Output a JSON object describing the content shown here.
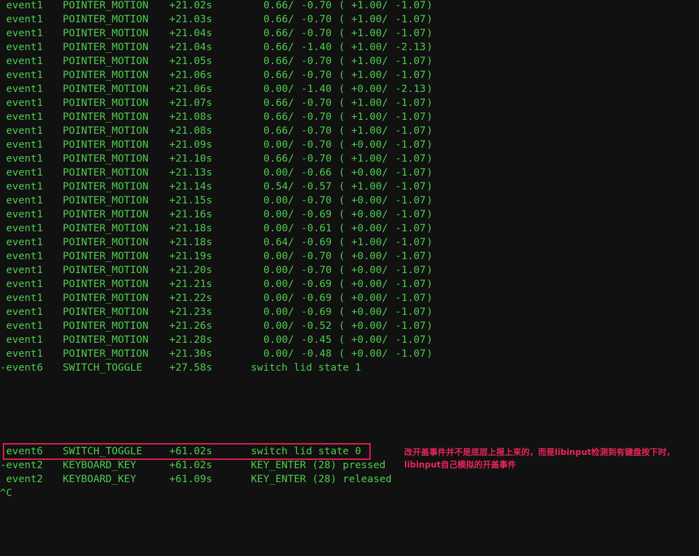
{
  "colors": {
    "background": "#111111",
    "text": "#4ece4e",
    "annotation": "#e8265a"
  },
  "motion_rows": [
    {
      "device": " event1",
      "type": "POINTER_MOTION",
      "time": "+21.02s",
      "m1": "0.66/",
      "m2": "-0.70",
      "lp": "(",
      "p1": "+1.00/",
      "p2": "-1.07",
      "rp": ")"
    },
    {
      "device": " event1",
      "type": "POINTER_MOTION",
      "time": "+21.03s",
      "m1": "0.66/",
      "m2": "-0.70",
      "lp": "(",
      "p1": "+1.00/",
      "p2": "-1.07",
      "rp": ")"
    },
    {
      "device": " event1",
      "type": "POINTER_MOTION",
      "time": "+21.04s",
      "m1": "0.66/",
      "m2": "-0.70",
      "lp": "(",
      "p1": "+1.00/",
      "p2": "-1.07",
      "rp": ")"
    },
    {
      "device": " event1",
      "type": "POINTER_MOTION",
      "time": "+21.04s",
      "m1": "0.66/",
      "m2": "-1.40",
      "lp": "(",
      "p1": "+1.00/",
      "p2": "-2.13",
      "rp": ")"
    },
    {
      "device": " event1",
      "type": "POINTER_MOTION",
      "time": "+21.05s",
      "m1": "0.66/",
      "m2": "-0.70",
      "lp": "(",
      "p1": "+1.00/",
      "p2": "-1.07",
      "rp": ")"
    },
    {
      "device": " event1",
      "type": "POINTER_MOTION",
      "time": "+21.06s",
      "m1": "0.66/",
      "m2": "-0.70",
      "lp": "(",
      "p1": "+1.00/",
      "p2": "-1.07",
      "rp": ")"
    },
    {
      "device": " event1",
      "type": "POINTER_MOTION",
      "time": "+21.06s",
      "m1": "0.00/",
      "m2": "-1.40",
      "lp": "(",
      "p1": "+0.00/",
      "p2": "-2.13",
      "rp": ")"
    },
    {
      "device": " event1",
      "type": "POINTER_MOTION",
      "time": "+21.07s",
      "m1": "0.66/",
      "m2": "-0.70",
      "lp": "(",
      "p1": "+1.00/",
      "p2": "-1.07",
      "rp": ")"
    },
    {
      "device": " event1",
      "type": "POINTER_MOTION",
      "time": "+21.08s",
      "m1": "0.66/",
      "m2": "-0.70",
      "lp": "(",
      "p1": "+1.00/",
      "p2": "-1.07",
      "rp": ")"
    },
    {
      "device": " event1",
      "type": "POINTER_MOTION",
      "time": "+21.08s",
      "m1": "0.66/",
      "m2": "-0.70",
      "lp": "(",
      "p1": "+1.00/",
      "p2": "-1.07",
      "rp": ")"
    },
    {
      "device": " event1",
      "type": "POINTER_MOTION",
      "time": "+21.09s",
      "m1": "0.00/",
      "m2": "-0.70",
      "lp": "(",
      "p1": "+0.00/",
      "p2": "-1.07",
      "rp": ")"
    },
    {
      "device": " event1",
      "type": "POINTER_MOTION",
      "time": "+21.10s",
      "m1": "0.66/",
      "m2": "-0.70",
      "lp": "(",
      "p1": "+1.00/",
      "p2": "-1.07",
      "rp": ")"
    },
    {
      "device": " event1",
      "type": "POINTER_MOTION",
      "time": "+21.13s",
      "m1": "0.00/",
      "m2": "-0.66",
      "lp": "(",
      "p1": "+0.00/",
      "p2": "-1.07",
      "rp": ")"
    },
    {
      "device": " event1",
      "type": "POINTER_MOTION",
      "time": "+21.14s",
      "m1": "0.54/",
      "m2": "-0.57",
      "lp": "(",
      "p1": "+1.00/",
      "p2": "-1.07",
      "rp": ")"
    },
    {
      "device": " event1",
      "type": "POINTER_MOTION",
      "time": "+21.15s",
      "m1": "0.00/",
      "m2": "-0.70",
      "lp": "(",
      "p1": "+0.00/",
      "p2": "-1.07",
      "rp": ")"
    },
    {
      "device": " event1",
      "type": "POINTER_MOTION",
      "time": "+21.16s",
      "m1": "0.00/",
      "m2": "-0.69",
      "lp": "(",
      "p1": "+0.00/",
      "p2": "-1.07",
      "rp": ")"
    },
    {
      "device": " event1",
      "type": "POINTER_MOTION",
      "time": "+21.18s",
      "m1": "0.00/",
      "m2": "-0.61",
      "lp": "(",
      "p1": "+0.00/",
      "p2": "-1.07",
      "rp": ")"
    },
    {
      "device": " event1",
      "type": "POINTER_MOTION",
      "time": "+21.18s",
      "m1": "0.64/",
      "m2": "-0.69",
      "lp": "(",
      "p1": "+1.00/",
      "p2": "-1.07",
      "rp": ")"
    },
    {
      "device": " event1",
      "type": "POINTER_MOTION",
      "time": "+21.19s",
      "m1": "0.00/",
      "m2": "-0.70",
      "lp": "(",
      "p1": "+0.00/",
      "p2": "-1.07",
      "rp": ")"
    },
    {
      "device": " event1",
      "type": "POINTER_MOTION",
      "time": "+21.20s",
      "m1": "0.00/",
      "m2": "-0.70",
      "lp": "(",
      "p1": "+0.00/",
      "p2": "-1.07",
      "rp": ")"
    },
    {
      "device": " event1",
      "type": "POINTER_MOTION",
      "time": "+21.21s",
      "m1": "0.00/",
      "m2": "-0.69",
      "lp": "(",
      "p1": "+0.00/",
      "p2": "-1.07",
      "rp": ")"
    },
    {
      "device": " event1",
      "type": "POINTER_MOTION",
      "time": "+21.22s",
      "m1": "0.00/",
      "m2": "-0.69",
      "lp": "(",
      "p1": "+0.00/",
      "p2": "-1.07",
      "rp": ")"
    },
    {
      "device": " event1",
      "type": "POINTER_MOTION",
      "time": "+21.23s",
      "m1": "0.00/",
      "m2": "-0.69",
      "lp": "(",
      "p1": "+0.00/",
      "p2": "-1.07",
      "rp": ")"
    },
    {
      "device": " event1",
      "type": "POINTER_MOTION",
      "time": "+21.26s",
      "m1": "0.00/",
      "m2": "-0.52",
      "lp": "(",
      "p1": "+0.00/",
      "p2": "-1.07",
      "rp": ")"
    },
    {
      "device": " event1",
      "type": "POINTER_MOTION",
      "time": "+21.28s",
      "m1": "0.00/",
      "m2": "-0.45",
      "lp": "(",
      "p1": "+0.00/",
      "p2": "-1.07",
      "rp": ")"
    },
    {
      "device": " event1",
      "type": "POINTER_MOTION",
      "time": "+21.30s",
      "m1": "0.00/",
      "m2": "-0.48",
      "lp": "(",
      "p1": "+0.00/",
      "p2": "-1.07",
      "rp": ")"
    }
  ],
  "other_rows": [
    {
      "device": "-event6",
      "type": "SWITCH_TOGGLE",
      "time": "+27.58s",
      "desc": "switch lid state 1"
    },
    {
      "device": " event6",
      "type": "SWITCH_TOGGLE",
      "time": "+61.02s",
      "desc": "switch lid state 0"
    },
    {
      "device": "-event2",
      "type": "KEYBOARD_KEY",
      "time": "+61.02s",
      "desc": "KEY_ENTER (28) pressed"
    },
    {
      "device": " event2",
      "type": "KEYBOARD_KEY",
      "time": "+61.09s",
      "desc": "KEY_ENTER (28) released"
    }
  ],
  "interrupt": "^C",
  "annotation": {
    "line1": "改开盖事件并不是底层上报上来的，而是libinput检测到有键盘按下时，",
    "line2": "libinput自己模拟的开盖事件"
  }
}
